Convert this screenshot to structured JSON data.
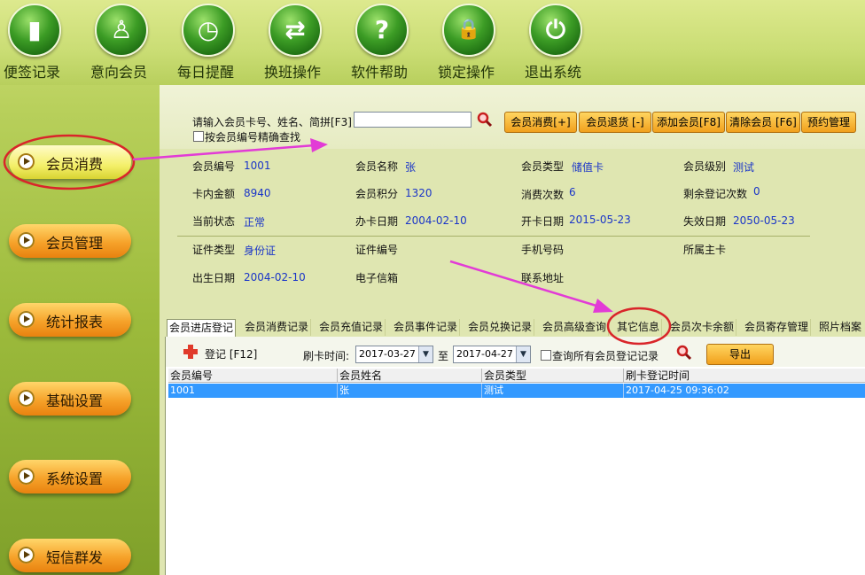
{
  "toolbar": {
    "items": [
      {
        "label": "便签记录",
        "icon": "document-icon",
        "glyph": "▮"
      },
      {
        "label": "意向会员",
        "icon": "person-icon",
        "glyph": "♙"
      },
      {
        "label": "每日提醒",
        "icon": "alarm-clock-icon",
        "glyph": "◷"
      },
      {
        "label": "换班操作",
        "icon": "swap-arrows-icon",
        "glyph": "⇄"
      },
      {
        "label": "软件帮助",
        "icon": "help-icon",
        "glyph": "?"
      },
      {
        "label": "锁定操作",
        "icon": "lock-icon",
        "glyph": "🔒"
      },
      {
        "label": "退出系统",
        "icon": "power-icon",
        "glyph": "⏻"
      }
    ]
  },
  "nav": {
    "items": [
      {
        "label": "会员消费",
        "active": true
      },
      {
        "label": "会员管理"
      },
      {
        "label": "统计报表"
      },
      {
        "label": "基础设置"
      },
      {
        "label": "系统设置"
      },
      {
        "label": "短信群发"
      }
    ]
  },
  "search": {
    "prompt": "请输入会员卡号、姓名、简拼[F3]",
    "value": "",
    "exact_label": "按会员编号精确查找",
    "buttons": [
      "会员消费[+]",
      "会员退货 [-]",
      "添加会员[F8]",
      "清除会员 [F6]",
      "预约管理"
    ]
  },
  "member": {
    "fields": [
      {
        "label": "会员编号",
        "value": "1001"
      },
      {
        "label": "会员名称",
        "value": "张"
      },
      {
        "label": "会员类型",
        "value": "储值卡"
      },
      {
        "label": "会员级别",
        "value": "测试"
      },
      {
        "label": "卡内金额",
        "value": "8940"
      },
      {
        "label": "会员积分",
        "value": "1320"
      },
      {
        "label": "消费次数",
        "value": "6"
      },
      {
        "label": "剩余登记次数",
        "value": "0"
      },
      {
        "label": "当前状态",
        "value": "正常"
      },
      {
        "label": "办卡日期",
        "value": "2004-02-10"
      },
      {
        "label": "开卡日期",
        "value": "2015-05-23"
      },
      {
        "label": "失效日期",
        "value": "2050-05-23"
      },
      {
        "label": "证件类型",
        "value": "身份证"
      },
      {
        "label": "证件编号",
        "value": ""
      },
      {
        "label": "手机号码",
        "value": ""
      },
      {
        "label": "所属主卡",
        "value": ""
      },
      {
        "label": "出生日期",
        "value": "2004-02-10"
      },
      {
        "label": "电子信箱",
        "value": ""
      },
      {
        "label": "联系地址",
        "value": ""
      }
    ]
  },
  "tabs": [
    "会员进店登记",
    "会员消费记录",
    "会员充值记录",
    "会员事件记录",
    "会员兑换记录",
    "会员高级查询",
    "其它信息",
    "会员次卡余额",
    "会员寄存管理",
    "照片档案"
  ],
  "grid": {
    "register_label": "登记 [F12]",
    "time_label": "刷卡时间:",
    "date_from": "2017-03-27",
    "to_label": "至",
    "date_to": "2017-04-27",
    "all_label": "查询所有会员登记记录",
    "export_label": "导出",
    "columns": [
      "会员编号",
      "会员姓名",
      "会员类型",
      "刷卡登记时间"
    ],
    "rows": [
      [
        "1001",
        "张",
        "测试",
        "2017-04-25 09:36:02"
      ]
    ]
  },
  "colors": {
    "accent": "#f1a01c",
    "value_text": "#1a35c8",
    "selection": "#3399ff",
    "annotation": "#e23bd6",
    "circle": "#d9252a"
  }
}
